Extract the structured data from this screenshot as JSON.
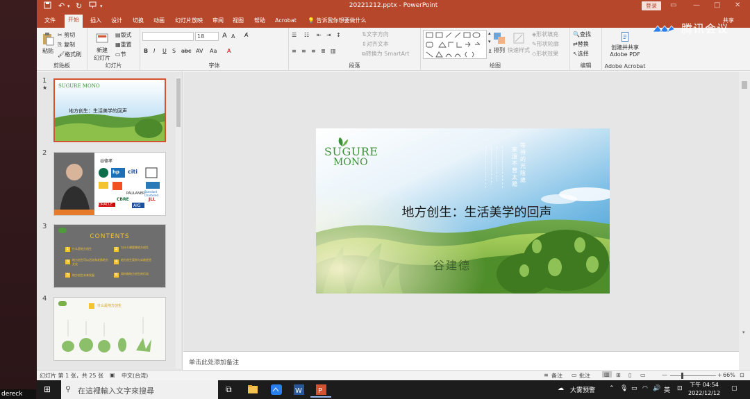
{
  "titlebar": {
    "doc_title": "20221212.pptx  -  PowerPoint",
    "login": "登录",
    "share": "共享"
  },
  "tabs": [
    "文件",
    "开始",
    "插入",
    "设计",
    "切换",
    "动画",
    "幻灯片放映",
    "审阅",
    "视图",
    "帮助",
    "Acrobat"
  ],
  "active_tab": "开始",
  "tell_me": "告诉我你想要做什么",
  "ribbon": {
    "clipboard": {
      "paste": "粘贴",
      "cut": "剪切",
      "copy": "复制",
      "format_painter": "格式刷",
      "label": "剪贴板"
    },
    "slides": {
      "new_slide": "新建",
      "new_slide2": "幻灯片",
      "layout": "版式",
      "reset": "重置",
      "section": "节",
      "label": "幻灯片"
    },
    "font": {
      "font_size": "18",
      "label": "字体"
    },
    "paragraph": {
      "text_direction": "文字方向",
      "align_text": "对齐文本",
      "smartart": "转换为 SmartArt",
      "label": "段落"
    },
    "drawing": {
      "arrange": "排列",
      "quick_styles": "快速样式",
      "shape_fill": "形状填充",
      "shape_outline": "形状轮廓",
      "shape_effects": "形状效果",
      "label": "绘图"
    },
    "editing": {
      "find": "查找",
      "replace": "替换",
      "select": "选择",
      "label": "编辑"
    },
    "acrobat": {
      "create_share": "创建并共享",
      "adobe_pdf": "Adobe PDF",
      "label": "Adobe Acrobat"
    }
  },
  "meeting_brand": "腾讯会议",
  "thumbnails": [
    {
      "num": "1",
      "star": "★",
      "logo": "SUGURE MONO",
      "title": "地方创生：生活美学的回声"
    },
    {
      "num": "2",
      "name": "谷德孝",
      "brands": [
        "hp",
        "citi",
        "PAULANER",
        "CBRE",
        "ORACLE",
        "AIG",
        "JLL",
        "Standard Chartered"
      ]
    },
    {
      "num": "3",
      "heading": "CONTENTS",
      "items": [
        {
          "n": "1",
          "text": "什么是地方创生"
        },
        {
          "n": "2",
          "text": "为什么想要做地方创生"
        },
        {
          "n": "3",
          "text": "地方创生可以活化和发扬地方文化"
        },
        {
          "n": "4",
          "text": "地方创生案例与实践经验"
        },
        {
          "n": "5",
          "text": "地方创生未来发展"
        },
        {
          "n": "6",
          "text": "如何做地方创生的行动"
        }
      ]
    },
    {
      "num": "4",
      "heading": "什么是地方创生"
    }
  ],
  "slide": {
    "logo_line1": "SUGURE",
    "logo_line2": "MONO",
    "title": "地方创生：生活美学的回声",
    "presenter": "谷建德",
    "vertical_poem": [
      "家",
      "遠",
      "不",
      "曾",
      "太",
      "陽",
      "等",
      "待",
      "的",
      "光",
      "陰",
      "歲"
    ]
  },
  "notes_placeholder": "单击此处添加备注",
  "status": {
    "slide_info": "幻灯片 第 1 张，共 25 张",
    "language": "中文(台湾)",
    "notes": "备注",
    "comments": "批注",
    "zoom": "66%"
  },
  "taskbar": {
    "search_placeholder": "在這裡輸入文字來搜尋",
    "weather": "大雾预警",
    "ime": "英",
    "time": "下午 04:54",
    "date": "2022/12/12",
    "user": "dereck"
  }
}
